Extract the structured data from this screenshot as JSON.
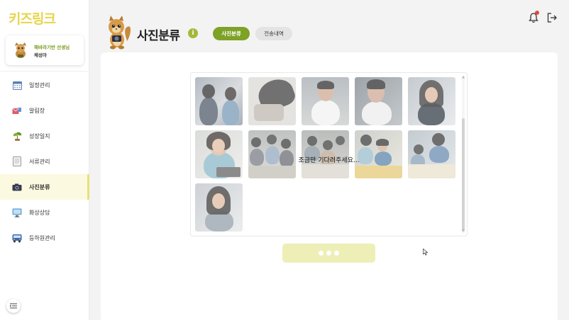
{
  "app": {
    "logo": "키즈링크"
  },
  "profile": {
    "school": "해바라기반 선생님",
    "name": "채성아"
  },
  "sidebar": {
    "items": [
      {
        "label": "일정관리",
        "icon": "calendar-icon"
      },
      {
        "label": "알림장",
        "icon": "mail-icon"
      },
      {
        "label": "성장일지",
        "icon": "sprout-icon"
      },
      {
        "label": "서류관리",
        "icon": "document-icon"
      },
      {
        "label": "사진분류",
        "icon": "camera-icon",
        "active": true
      },
      {
        "label": "화상상담",
        "icon": "monitor-icon"
      },
      {
        "label": "등하원관리",
        "icon": "bus-icon"
      }
    ]
  },
  "header": {
    "title": "사진분류",
    "info_icon": "i",
    "tabs": [
      {
        "label": "사진분류",
        "active": true
      },
      {
        "label": "전송내역",
        "active": false
      }
    ]
  },
  "main": {
    "loading_text": "조금만 기다려주세요...",
    "photo_count": 11,
    "send_button": {
      "state": "loading",
      "icon": "three-dots-loading"
    }
  },
  "colors": {
    "accent": "#7da226",
    "logo": "#e6d54a",
    "button_disabled": "#eeeeb7",
    "notification": "#e24a3b"
  }
}
